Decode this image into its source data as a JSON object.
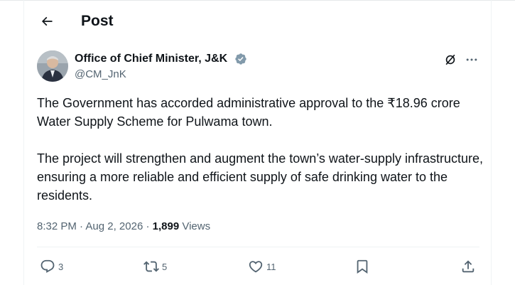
{
  "header": {
    "title": "Post",
    "back_icon": "arrow-left-icon"
  },
  "author": {
    "name": "Office of Chief Minister, J&K",
    "handle": "@CM_JnK",
    "verified_color": "#829aab"
  },
  "post": {
    "paragraph1": "The Government has accorded administrative approval to the ₹18.96 crore Water Supply Scheme for Pulwama town.",
    "paragraph2": "The project will strengthen and augment the town’s water-supply infrastructure, ensuring a more reliable and efficient supply of safe drinking water to the residents.",
    "time": "8:32 PM",
    "separator": "·",
    "date": "Aug 2, 2026",
    "views_count": "1,899",
    "views_label": "Views"
  },
  "actions": {
    "replies": "3",
    "reposts": "5",
    "likes": "11"
  },
  "colors": {
    "text": "#0f1419",
    "secondary": "#536471",
    "border": "#eff3f4"
  }
}
